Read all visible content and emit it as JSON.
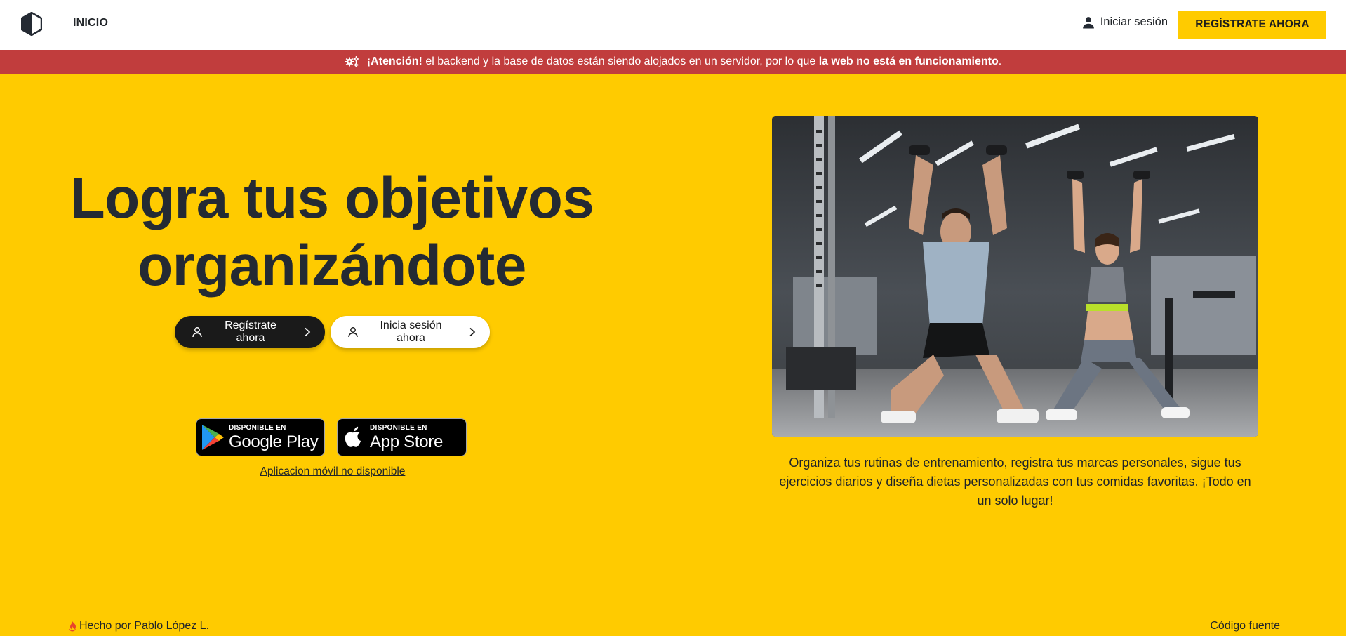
{
  "header": {
    "nav_home": "INICIO",
    "login_label": "Iniciar sesión",
    "register_label": "REGÍSTRATE AHORA"
  },
  "alert": {
    "strong_prefix": "¡Atención!",
    "text": " el backend y la base de datos están siendo alojados en un servidor, por lo que ",
    "strong_suffix": "la web no está en funcionamiento",
    "end": "."
  },
  "hero": {
    "title_line1": "Logra tus objetivos",
    "title_line2": "organizándote",
    "register_button": "Regístrate ahora",
    "login_button": "Inicia sesión ahora",
    "description": "Organiza tus rutinas de entrenamiento, registra tus marcas personales, sigue tus ejercicios diarios y diseña dietas personalizadas con tus comidas favoritas. ¡Todo en un solo lugar!"
  },
  "stores": {
    "google_small": "DISPONIBLE EN",
    "google_big": "Google Play",
    "apple_small": "DISPONIBLE EN",
    "apple_big": "App Store",
    "note": "Aplicacion móvil no disponible"
  },
  "footer": {
    "credit": "Hecho por Pablo López L.",
    "source": "Código fuente"
  },
  "colors": {
    "accent": "#ffcb00",
    "alert": "#c13d3d",
    "dark": "#242a33"
  }
}
